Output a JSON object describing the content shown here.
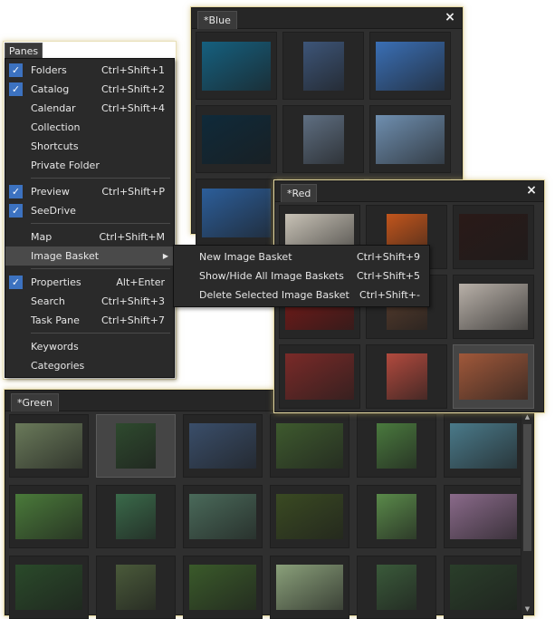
{
  "panes_button": "Panes",
  "panes_menu": {
    "items": [
      {
        "label": "Folders",
        "shortcut": "Ctrl+Shift+1",
        "checked": true
      },
      {
        "label": "Catalog",
        "shortcut": "Ctrl+Shift+2",
        "checked": true
      },
      {
        "label": "Calendar",
        "shortcut": "Ctrl+Shift+4",
        "checked": false
      },
      {
        "label": "Collection",
        "shortcut": "",
        "checked": false
      },
      {
        "label": "Shortcuts",
        "shortcut": "",
        "checked": false
      },
      {
        "label": "Private Folder",
        "shortcut": "",
        "checked": false
      },
      {
        "label": "Preview",
        "shortcut": "Ctrl+Shift+P",
        "checked": true
      },
      {
        "label": "SeeDrive",
        "shortcut": "",
        "checked": true
      },
      {
        "label": "Map",
        "shortcut": "Ctrl+Shift+M",
        "checked": false
      },
      {
        "label": "Image Basket",
        "shortcut": "",
        "checked": false,
        "submenu": true,
        "highlighted": true
      },
      {
        "label": "Properties",
        "shortcut": "Alt+Enter",
        "checked": true
      },
      {
        "label": "Search",
        "shortcut": "Ctrl+Shift+3",
        "checked": false
      },
      {
        "label": "Task Pane",
        "shortcut": "Ctrl+Shift+7",
        "checked": false
      },
      {
        "label": "Keywords",
        "shortcut": "",
        "checked": false
      },
      {
        "label": "Categories",
        "shortcut": "",
        "checked": false
      }
    ]
  },
  "submenu": {
    "items": [
      {
        "label": "New Image Basket",
        "shortcut": "Ctrl+Shift+9"
      },
      {
        "label": "Show/Hide All Image Baskets",
        "shortcut": "Ctrl+Shift+5"
      },
      {
        "label": "Delete Selected Image Basket",
        "shortcut": "Ctrl+Shift+-"
      }
    ]
  },
  "baskets": {
    "blue": {
      "title": "*Blue",
      "colors": [
        "#15607f",
        "#3d5578",
        "#3a6fb5",
        "#0f2a3a",
        "#5f6f82",
        "#6f8fb0",
        "#2c5e9a",
        "#8aa8c8",
        "#7aa0c8"
      ]
    },
    "red": {
      "title": "*Red",
      "colors": [
        "#c8c2b6",
        "#c2551c",
        "#2a1a18",
        "#7a1a18",
        "#5a3e2e",
        "#b8b0a8",
        "#7a2a28",
        "#b24a3e",
        "#a0583a"
      ]
    },
    "green": {
      "title": "*Green",
      "colors": [
        "#6a7a5a",
        "#2e4a2e",
        "#3a4e6a",
        "#3e5a2e",
        "#4a7a3e",
        "#4a7a8a",
        "#4a7a3a",
        "#3a6a4a",
        "#4a6a5a",
        "#3a4a22",
        "#5a8a4a",
        "#8a6a8a",
        "#2a4a2a",
        "#4a5a3a",
        "#3a5a2a",
        "#8aa07a",
        "#3a5a3a",
        "#2a3e2a"
      ]
    }
  },
  "icons": {
    "close": "close-icon",
    "check": "check-icon",
    "submenu_arrow": "chevron-right-icon"
  },
  "close_glyph": "×",
  "check_glyph": "✓",
  "arrow_glyph": "▶"
}
